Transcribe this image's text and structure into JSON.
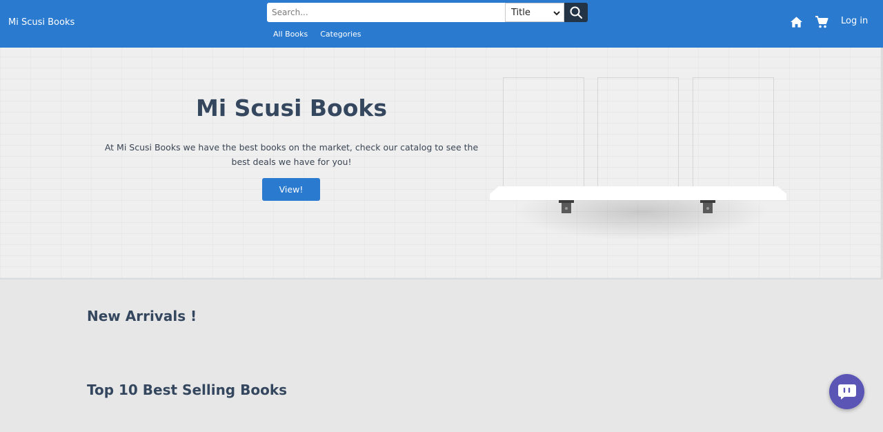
{
  "header": {
    "brand": "Mi Scusi Books",
    "search_placeholder": "Search...",
    "search_type_selected": "Title",
    "nav_links": [
      "All Books",
      "Categories"
    ],
    "login_label": "Log in",
    "icons": [
      "search-icon",
      "home-icon",
      "cart-icon",
      "chevron-down-icon"
    ]
  },
  "hero": {
    "title": "Mi Scusi Books",
    "description": "At Mi Scusi Books we have the best books on the market, check our catalog to see the best deals we have for you!",
    "button_label": "View!"
  },
  "sections": {
    "new_arrivals": "New Arrivals !",
    "best_selling": "Top 10 Best Selling Books"
  },
  "chat": {
    "icon": "chat-bubble-icon"
  },
  "colors": {
    "primary": "#2a7acf",
    "dark": "#243447",
    "heading": "#34475e",
    "page_bg": "#e7e7e8",
    "chat": "#5b55b5"
  }
}
